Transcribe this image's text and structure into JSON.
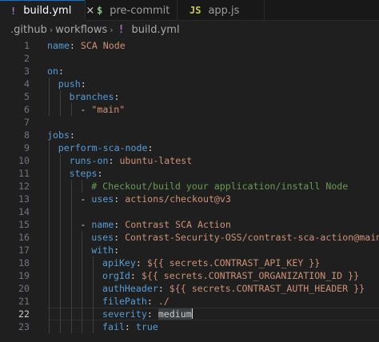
{
  "tabs": [
    {
      "icon": "!",
      "icon_color": "#a074c4",
      "label": "build.yml",
      "active": true,
      "close": "×"
    },
    {
      "icon": "$",
      "icon_color": "#8dc891",
      "label": "pre-commit",
      "active": false
    },
    {
      "icon": "JS",
      "icon_color": "#cbcb41",
      "label": "app.js",
      "active": false
    }
  ],
  "breadcrumb": {
    "folder1": ".github",
    "folder2": "workflows",
    "file_icon": "!",
    "file": "build.yml"
  },
  "editor": {
    "current_line": 22,
    "lines": [
      {
        "n": "1",
        "indent": 0,
        "tokens": [
          [
            "k",
            "name"
          ],
          [
            "p",
            ": "
          ],
          [
            "s",
            "SCA Node"
          ]
        ]
      },
      {
        "n": "2",
        "indent": 0,
        "tokens": []
      },
      {
        "n": "3",
        "indent": 0,
        "tokens": [
          [
            "k",
            "on"
          ],
          [
            "p",
            ":"
          ]
        ]
      },
      {
        "n": "4",
        "indent": 1,
        "tokens": [
          [
            "k",
            "push"
          ],
          [
            "p",
            ":"
          ]
        ]
      },
      {
        "n": "5",
        "indent": 2,
        "tokens": [
          [
            "k",
            "branches"
          ],
          [
            "p",
            ":"
          ]
        ]
      },
      {
        "n": "6",
        "indent": 3,
        "tokens": [
          [
            "p",
            "- "
          ],
          [
            "s",
            "\"main\""
          ]
        ]
      },
      {
        "n": "7",
        "indent": 0,
        "tokens": []
      },
      {
        "n": "8",
        "indent": 0,
        "tokens": [
          [
            "k",
            "jobs"
          ],
          [
            "p",
            ":"
          ]
        ]
      },
      {
        "n": "9",
        "indent": 1,
        "tokens": [
          [
            "k",
            "perform-sca-node"
          ],
          [
            "p",
            ":"
          ]
        ]
      },
      {
        "n": "10",
        "indent": 2,
        "tokens": [
          [
            "k",
            "runs-on"
          ],
          [
            "p",
            ": "
          ],
          [
            "s",
            "ubuntu-latest"
          ]
        ]
      },
      {
        "n": "11",
        "indent": 2,
        "tokens": [
          [
            "k",
            "steps"
          ],
          [
            "p",
            ":"
          ]
        ]
      },
      {
        "n": "12",
        "indent": 4,
        "tokens": [
          [
            "c",
            "# Checkout/build your application/install Node"
          ]
        ]
      },
      {
        "n": "13",
        "indent": 3,
        "tokens": [
          [
            "p",
            "- "
          ],
          [
            "k",
            "uses"
          ],
          [
            "p",
            ": "
          ],
          [
            "s",
            "actions/checkout@v3"
          ]
        ]
      },
      {
        "n": "14",
        "indent": 0,
        "tokens": []
      },
      {
        "n": "15",
        "indent": 3,
        "tokens": [
          [
            "p",
            "- "
          ],
          [
            "k",
            "name"
          ],
          [
            "p",
            ": "
          ],
          [
            "s",
            "Contrast SCA Action"
          ]
        ]
      },
      {
        "n": "16",
        "indent": 4,
        "tokens": [
          [
            "k",
            "uses"
          ],
          [
            "p",
            ": "
          ],
          [
            "s",
            "Contrast-Security-OSS/contrast-sca-action@main"
          ]
        ]
      },
      {
        "n": "17",
        "indent": 4,
        "tokens": [
          [
            "k",
            "with"
          ],
          [
            "p",
            ":"
          ]
        ]
      },
      {
        "n": "18",
        "indent": 5,
        "tokens": [
          [
            "k",
            "apiKey"
          ],
          [
            "p",
            ": "
          ],
          [
            "s",
            "${{ secrets.CONTRAST_API_KEY }}"
          ]
        ]
      },
      {
        "n": "19",
        "indent": 5,
        "tokens": [
          [
            "k",
            "orgId"
          ],
          [
            "p",
            ": "
          ],
          [
            "s",
            "${{ secrets.CONTRAST_ORGANIZATION_ID }}"
          ]
        ]
      },
      {
        "n": "20",
        "indent": 5,
        "tokens": [
          [
            "k",
            "authHeader"
          ],
          [
            "p",
            ": "
          ],
          [
            "s",
            "${{ secrets.CONTRAST_AUTH_HEADER }}"
          ]
        ]
      },
      {
        "n": "21",
        "indent": 5,
        "tokens": [
          [
            "k",
            "filePath"
          ],
          [
            "p",
            ": "
          ],
          [
            "s",
            "./"
          ]
        ]
      },
      {
        "n": "22",
        "indent": 5,
        "tokens": [
          [
            "k",
            "severity"
          ],
          [
            "p",
            ": "
          ],
          [
            "sel",
            "medium"
          ]
        ]
      },
      {
        "n": "23",
        "indent": 5,
        "tokens": [
          [
            "k",
            "fail"
          ],
          [
            "p",
            ": "
          ],
          [
            "b",
            "true"
          ]
        ]
      }
    ]
  }
}
